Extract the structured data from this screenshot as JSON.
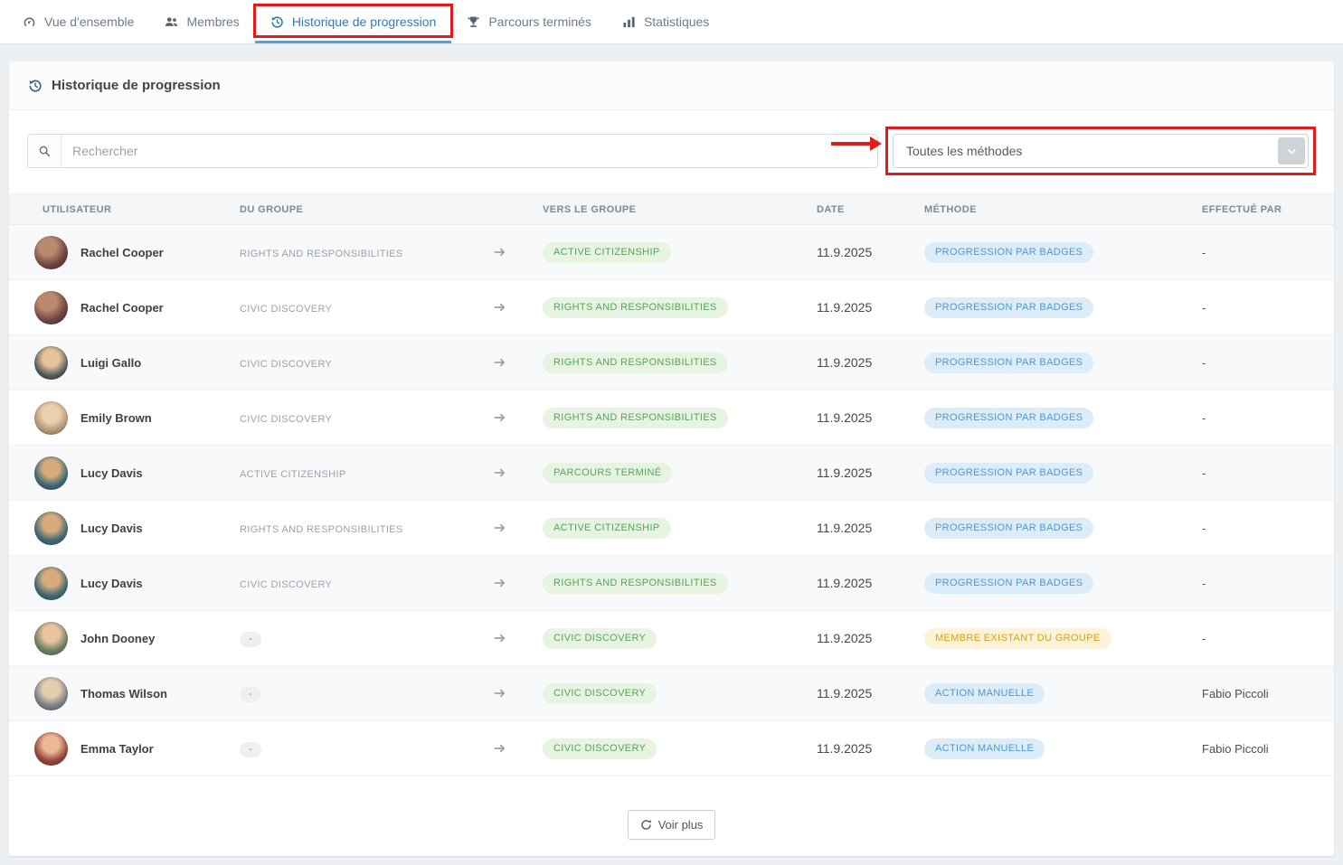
{
  "tabs": {
    "items": [
      {
        "label": "Vue d'ensemble"
      },
      {
        "label": "Membres"
      },
      {
        "label": "Historique de progression"
      },
      {
        "label": "Parcours terminés"
      },
      {
        "label": "Statistiques"
      }
    ],
    "active_index": 2
  },
  "panel": {
    "title": "Historique de progression"
  },
  "search": {
    "placeholder": "Rechercher"
  },
  "method_filter": {
    "selected": "Toutes les méthodes"
  },
  "table": {
    "headers": {
      "user": "UTILISATEUR",
      "from": "DU GROUPE",
      "to": "VERS LE GROUPE",
      "date": "DATE",
      "method": "MÉTHODE",
      "by": "EFFECTUÉ PAR"
    },
    "rows": [
      {
        "user": "Rachel Cooper",
        "from": "RIGHTS AND RESPONSIBILITIES",
        "to": "ACTIVE CITIZENSHIP",
        "date": "11.9.2025",
        "method": "PROGRESSION PAR BADGES",
        "method_variant": "blue",
        "by": "-"
      },
      {
        "user": "Rachel Cooper",
        "from": "CIVIC DISCOVERY",
        "to": "RIGHTS AND RESPONSIBILITIES",
        "date": "11.9.2025",
        "method": "PROGRESSION PAR BADGES",
        "method_variant": "blue",
        "by": "-"
      },
      {
        "user": "Luigi Gallo",
        "from": "CIVIC DISCOVERY",
        "to": "RIGHTS AND RESPONSIBILITIES",
        "date": "11.9.2025",
        "method": "PROGRESSION PAR BADGES",
        "method_variant": "blue",
        "by": "-"
      },
      {
        "user": "Emily Brown",
        "from": "CIVIC DISCOVERY",
        "to": "RIGHTS AND RESPONSIBILITIES",
        "date": "11.9.2025",
        "method": "PROGRESSION PAR BADGES",
        "method_variant": "blue",
        "by": "-"
      },
      {
        "user": "Lucy Davis",
        "from": "ACTIVE CITIZENSHIP",
        "to": "PARCOURS TERMINÉ",
        "date": "11.9.2025",
        "method": "PROGRESSION PAR BADGES",
        "method_variant": "blue",
        "by": "-"
      },
      {
        "user": "Lucy Davis",
        "from": "RIGHTS AND RESPONSIBILITIES",
        "to": "ACTIVE CITIZENSHIP",
        "date": "11.9.2025",
        "method": "PROGRESSION PAR BADGES",
        "method_variant": "blue",
        "by": "-"
      },
      {
        "user": "Lucy Davis",
        "from": "CIVIC DISCOVERY",
        "to": "RIGHTS AND RESPONSIBILITIES",
        "date": "11.9.2025",
        "method": "PROGRESSION PAR BADGES",
        "method_variant": "blue",
        "by": "-"
      },
      {
        "user": "John Dooney",
        "from": "-",
        "to": "CIVIC DISCOVERY",
        "date": "11.9.2025",
        "method": "MEMBRE EXISTANT DU GROUPE",
        "method_variant": "yellow",
        "by": "-"
      },
      {
        "user": "Thomas Wilson",
        "from": "-",
        "to": "CIVIC DISCOVERY",
        "date": "11.9.2025",
        "method": "ACTION MANUELLE",
        "method_variant": "blue",
        "by": "Fabio Piccoli"
      },
      {
        "user": "Emma Taylor",
        "from": "-",
        "to": "CIVIC DISCOVERY",
        "date": "11.9.2025",
        "method": "ACTION MANUELLE",
        "method_variant": "blue",
        "by": "Fabio Piccoli"
      }
    ]
  },
  "footer": {
    "load_more": "Voir plus"
  },
  "colors": {
    "accent_blue": "#3679b5",
    "tab_underline": "#55a0d9",
    "badge_green_text": "#55a45b",
    "badge_blue_text": "#4e97d1",
    "badge_yellow_text": "#d9a013",
    "annotation_red": "#e01c1c"
  }
}
